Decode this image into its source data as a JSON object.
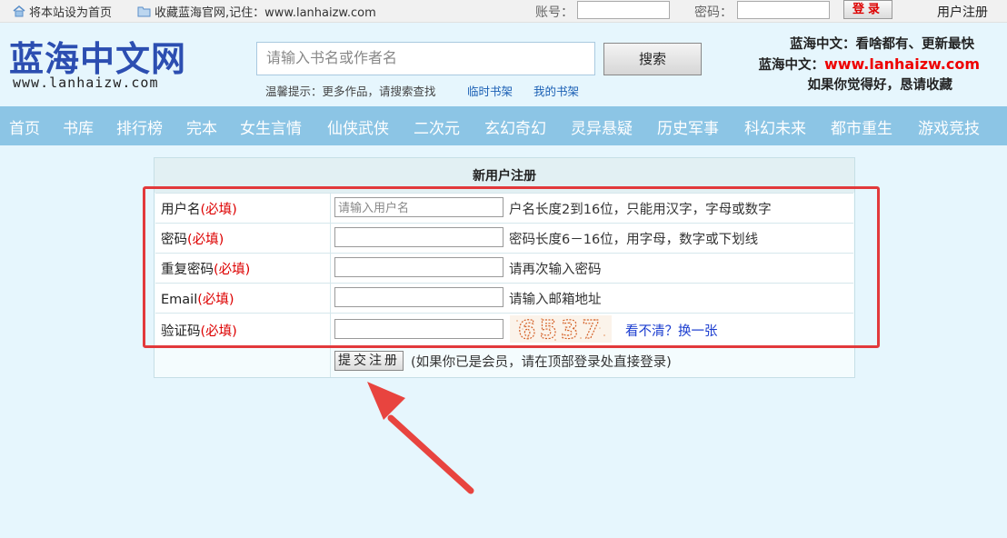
{
  "topbar": {
    "set_home": "将本站设为首页",
    "bookmark": "收藏蓝海官网,记住：www.lanhaizw.com",
    "account_label": "账号：",
    "password_label": "密码：",
    "login_button": "登录",
    "register_link": "用户注册"
  },
  "header": {
    "logo_cn": "蓝海中文网",
    "logo_en": "www.lanhaizw.com",
    "search_placeholder": "请输入书名或作者名",
    "search_button": "搜索",
    "tip": "温馨提示：更多作品，请搜索查找",
    "temp_shelf": "临时书架",
    "my_shelf": "我的书架",
    "slogan1": "蓝海中文：看啥都有、更新最快",
    "slogan2_prefix": "蓝海中文：",
    "slogan2_url": "www.lanhaizw.com",
    "slogan3": "如果你觉得好，恳请收藏"
  },
  "nav": {
    "items": [
      "首页",
      "书库",
      "排行榜",
      "完本",
      "女生言情",
      "仙侠武侠",
      "二次元",
      "玄幻奇幻",
      "灵异悬疑",
      "历史军事",
      "科幻未来",
      "都市重生",
      "游戏竞技"
    ]
  },
  "form": {
    "title": "新用户注册",
    "required": "(必填)",
    "username_label": "用户名",
    "username_placeholder": "请输入用户名",
    "username_hint": "户名长度2到16位，只能用汉字，字母或数字",
    "password_label": "密码",
    "password_hint": "密码长度6－16位，用字母，数字或下划线",
    "repeat_label": "重复密码",
    "repeat_hint": "请再次输入密码",
    "email_label": "Email",
    "email_hint": "请输入邮箱地址",
    "captcha_label": "验证码",
    "captcha_text": "6537",
    "captcha_refresh": "看不清？换一张",
    "submit_button": "提交注册",
    "submit_note": "(如果你已是会员，请在顶部登录处直接登录)"
  },
  "colors": {
    "nav_bg": "#8cc5e5",
    "logo": "#2c4eb1",
    "highlight": "#e2393b",
    "required": "#dd0000"
  }
}
